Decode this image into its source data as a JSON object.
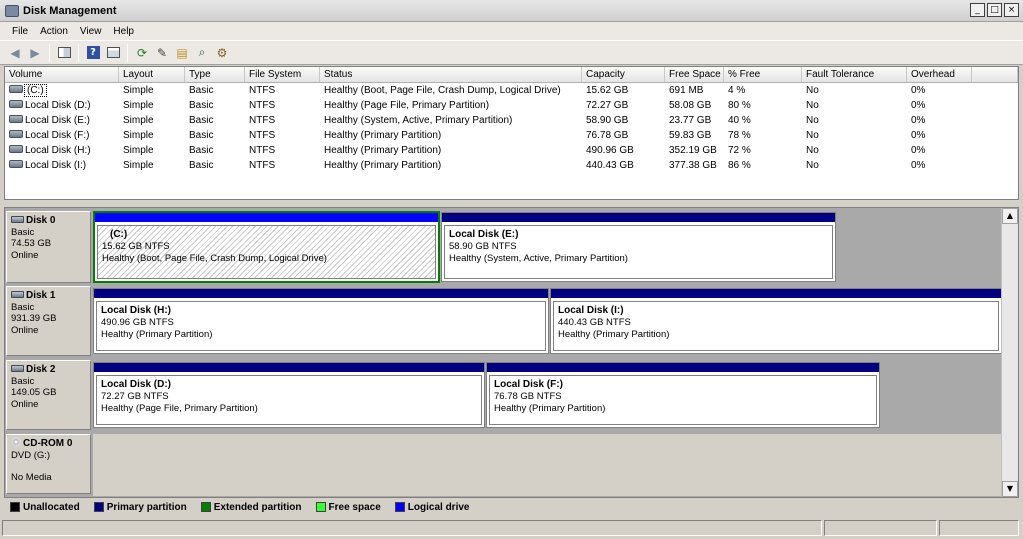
{
  "window": {
    "title": "Disk Management",
    "buttons": [
      "_",
      "□",
      "×"
    ]
  },
  "menu": [
    "File",
    "Action",
    "View",
    "Help"
  ],
  "toolbar_icons": [
    "back-arrow-icon",
    "forward-arrow-icon",
    "console-tree-icon",
    "help-icon",
    "properties-icon",
    "refresh-icon",
    "export-icon",
    "open-icon",
    "search-icon",
    "settings-icon"
  ],
  "volumes": {
    "columns": [
      "Volume",
      "Layout",
      "Type",
      "File System",
      "Status",
      "Capacity",
      "Free Space",
      "% Free",
      "Fault Tolerance",
      "Overhead"
    ],
    "rows": [
      [
        "(C:)",
        "Simple",
        "Basic",
        "NTFS",
        "Healthy (Boot, Page File, Crash Dump, Logical Drive)",
        "15.62 GB",
        "691 MB",
        "4 %",
        "No",
        "0%"
      ],
      [
        "Local Disk (D:)",
        "Simple",
        "Basic",
        "NTFS",
        "Healthy (Page File, Primary Partition)",
        "72.27 GB",
        "58.08 GB",
        "80 %",
        "No",
        "0%"
      ],
      [
        "Local Disk (E:)",
        "Simple",
        "Basic",
        "NTFS",
        "Healthy (System, Active, Primary Partition)",
        "58.90 GB",
        "23.77 GB",
        "40 %",
        "No",
        "0%"
      ],
      [
        "Local Disk (F:)",
        "Simple",
        "Basic",
        "NTFS",
        "Healthy (Primary Partition)",
        "76.78 GB",
        "59.83 GB",
        "78 %",
        "No",
        "0%"
      ],
      [
        "Local Disk (H:)",
        "Simple",
        "Basic",
        "NTFS",
        "Healthy (Primary Partition)",
        "490.96 GB",
        "352.19 GB",
        "72 %",
        "No",
        "0%"
      ],
      [
        "Local Disk (I:)",
        "Simple",
        "Basic",
        "NTFS",
        "Healthy (Primary Partition)",
        "440.43 GB",
        "377.38 GB",
        "86 %",
        "No",
        "0%"
      ]
    ]
  },
  "disks": [
    {
      "name": "Disk 0",
      "type": "Basic",
      "size": "74.53 GB",
      "state": "Online",
      "partitions": [
        {
          "name": "(C:)",
          "size": "15.62 GB NTFS",
          "status": "Healthy (Boot, Page File, Crash Dump, Logical Drive)"
        },
        {
          "name": "Local Disk  (E:)",
          "size": "58.90 GB NTFS",
          "status": "Healthy (System, Active, Primary Partition)"
        }
      ]
    },
    {
      "name": "Disk 1",
      "type": "Basic",
      "size": "931.39 GB",
      "state": "Online",
      "partitions": [
        {
          "name": "Local Disk  (H:)",
          "size": "490.96 GB NTFS",
          "status": "Healthy (Primary Partition)"
        },
        {
          "name": "Local Disk  (I:)",
          "size": "440.43 GB NTFS",
          "status": "Healthy (Primary Partition)"
        }
      ]
    },
    {
      "name": "Disk 2",
      "type": "Basic",
      "size": "149.05 GB",
      "state": "Online",
      "partitions": [
        {
          "name": "Local Disk  (D:)",
          "size": "72.27 GB NTFS",
          "status": "Healthy (Page File, Primary Partition)"
        },
        {
          "name": "Local Disk  (F:)",
          "size": "76.78 GB NTFS",
          "status": "Healthy (Primary Partition)"
        }
      ]
    },
    {
      "name": "CD-ROM 0",
      "type": "DVD (G:)",
      "size": "",
      "state": "No Media",
      "partitions": []
    }
  ],
  "legend": [
    {
      "label": "Unallocated",
      "color": "#000000"
    },
    {
      "label": "Primary partition",
      "color": "#000080"
    },
    {
      "label": "Extended partition",
      "color": "#008000"
    },
    {
      "label": "Free space",
      "color": "#33ff33"
    },
    {
      "label": "Logical drive",
      "color": "#0000ff"
    }
  ],
  "colors": {
    "primary": "#000080",
    "logical": "#0000ff",
    "extended": "#008000"
  }
}
